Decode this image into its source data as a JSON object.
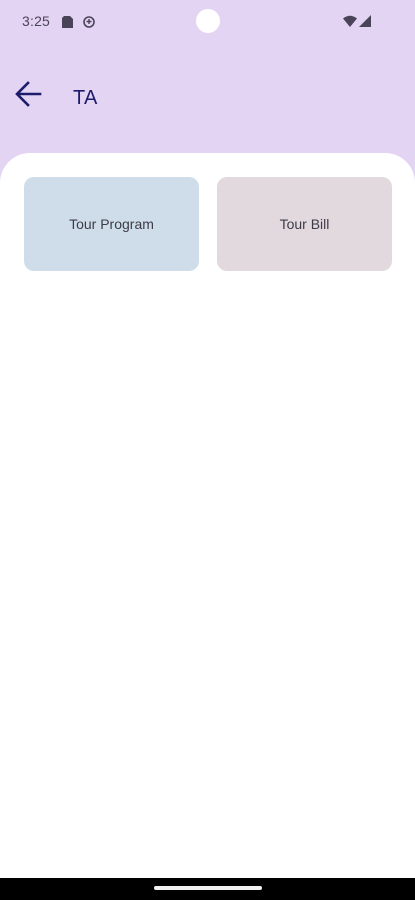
{
  "status_bar": {
    "time": "3:25",
    "icons": [
      "sim-card-icon",
      "sync-icon",
      "wifi-icon",
      "cell-signal-icon"
    ]
  },
  "app_bar": {
    "title": "TA",
    "back_icon": "arrow-back-icon"
  },
  "tiles": [
    {
      "label": "Tour Program",
      "color": "#cedde9"
    },
    {
      "label": "Tour Bill",
      "color": "#e2d9df"
    }
  ],
  "colors": {
    "header_background": "#e4d4f4",
    "title_color": "#1d1b6b",
    "content_background": "#ffffff"
  }
}
